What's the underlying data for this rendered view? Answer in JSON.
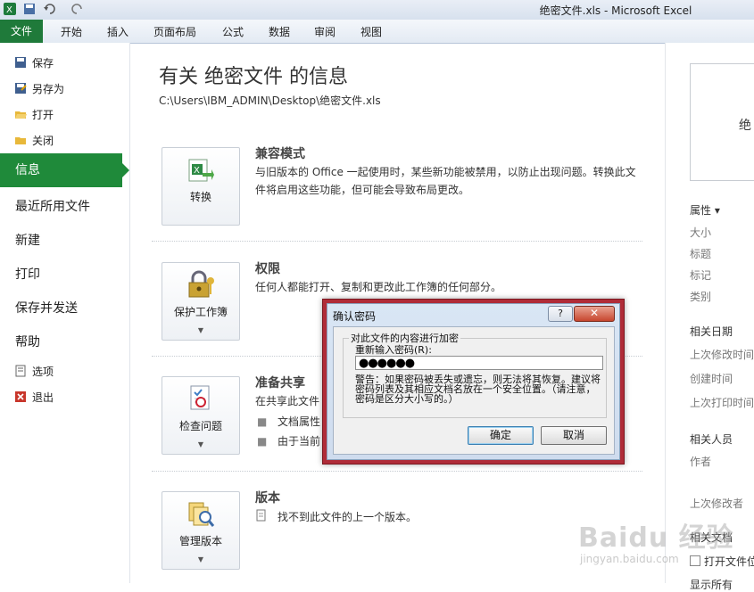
{
  "window": {
    "title": "绝密文件.xls  -  Microsoft Excel"
  },
  "ribbon": {
    "tabs": [
      "文件",
      "开始",
      "插入",
      "页面布局",
      "公式",
      "数据",
      "审阅",
      "视图"
    ]
  },
  "leftnav": {
    "small_items": [
      "保存",
      "另存为",
      "打开",
      "关闭"
    ],
    "active": "信息",
    "big_items": [
      "最近所用文件",
      "新建",
      "打印",
      "保存并发送",
      "帮助"
    ],
    "bottom_items": [
      "选项",
      "退出"
    ]
  },
  "info": {
    "title": "有关 绝密文件 的信息",
    "path": "C:\\Users\\IBM_ADMIN\\Desktop\\绝密文件.xls"
  },
  "sections": {
    "compat": {
      "button": "转换",
      "title": "兼容模式",
      "desc": "与旧版本的 Office 一起使用时，某些新功能被禁用，以防止出现问题。转换此文件将启用这些功能，但可能会导致布局更改。"
    },
    "perm": {
      "button": "保护工作簿",
      "title": "权限",
      "desc": "任何人都能打开、复制和更改此工作簿的任何部分。"
    },
    "share": {
      "button": "检查问题",
      "title": "准备共享",
      "desc": "在共享此文件",
      "bullets": [
        "文档属性",
        "由于当前"
      ]
    },
    "versions": {
      "button": "管理版本",
      "title": "版本",
      "desc": "找不到此文件的上一个版本。"
    }
  },
  "rightpanel": {
    "thumb_char": "绝",
    "properties_head": "属性 ▾",
    "properties": [
      "大小",
      "标题",
      "标记",
      "类别"
    ],
    "dates_head": "相关日期",
    "dates": [
      "上次修改时间",
      "创建时间",
      "上次打印时间"
    ],
    "people_head": "相关人员",
    "people": [
      "作者",
      "上次修改者"
    ],
    "docs_head": "相关文档",
    "docs": [
      "打开文件位"
    ],
    "more": "显示所有"
  },
  "dialog": {
    "title": "确认密码",
    "help": "?",
    "close": "✕",
    "group_label": "对此文件的内容进行加密",
    "field_label": "重新输入密码(R):",
    "password_mask": "●●●●●●",
    "warning": "警告：如果密码被丢失或遗忘，则无法将其恢复。建议将密码列表及其相应文档名放在一个安全位置。（请注意，密码是区分大小写的。）",
    "ok": "确定",
    "cancel": "取消"
  },
  "watermark": {
    "text": "Baidu 经验",
    "sub": "jingyan.baidu.com"
  },
  "colors": {
    "accent": "#1f8a3a",
    "dialog_border": "#b02c38"
  }
}
